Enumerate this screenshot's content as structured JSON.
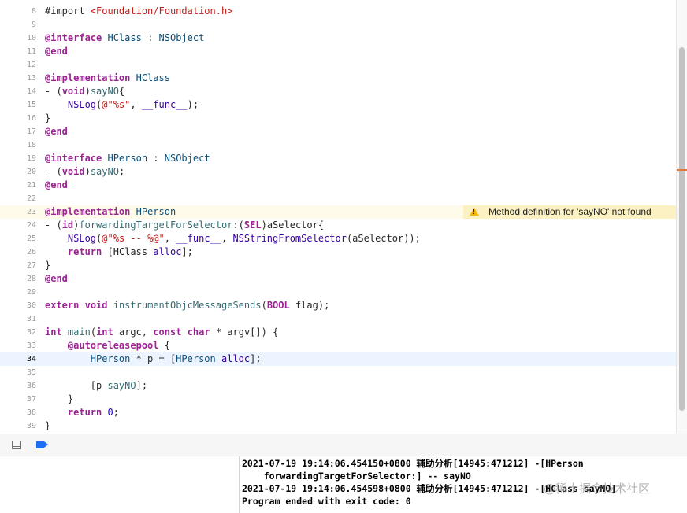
{
  "editor": {
    "lines": [
      {
        "num": "8",
        "tokens": [
          {
            "c": "",
            "t": "#import "
          },
          {
            "c": "s",
            "t": "<Foundation/Foundation.h>"
          }
        ]
      },
      {
        "num": "9",
        "tokens": []
      },
      {
        "num": "10",
        "tokens": [
          {
            "c": "k",
            "t": "@interface"
          },
          {
            "c": "",
            "t": " "
          },
          {
            "c": "t",
            "t": "HClass"
          },
          {
            "c": "",
            "t": " : "
          },
          {
            "c": "t",
            "t": "NSObject"
          }
        ]
      },
      {
        "num": "11",
        "tokens": [
          {
            "c": "k",
            "t": "@end"
          }
        ]
      },
      {
        "num": "12",
        "tokens": []
      },
      {
        "num": "13",
        "tokens": [
          {
            "c": "k",
            "t": "@implementation"
          },
          {
            "c": "",
            "t": " "
          },
          {
            "c": "t",
            "t": "HClass"
          }
        ]
      },
      {
        "num": "14",
        "tokens": [
          {
            "c": "",
            "t": "- ("
          },
          {
            "c": "k",
            "t": "void"
          },
          {
            "c": "",
            "t": ")"
          },
          {
            "c": "f",
            "t": "sayNO"
          },
          {
            "c": "",
            "t": "{"
          }
        ]
      },
      {
        "num": "15",
        "tokens": [
          {
            "c": "",
            "t": "    "
          },
          {
            "c": "m",
            "t": "NSLog"
          },
          {
            "c": "",
            "t": "("
          },
          {
            "c": "s",
            "t": "@\"%s\""
          },
          {
            "c": "",
            "t": ", "
          },
          {
            "c": "m",
            "t": "__func__"
          },
          {
            "c": "",
            "t": ");"
          }
        ]
      },
      {
        "num": "16",
        "tokens": [
          {
            "c": "",
            "t": "}"
          }
        ]
      },
      {
        "num": "17",
        "tokens": [
          {
            "c": "k",
            "t": "@end"
          }
        ]
      },
      {
        "num": "18",
        "tokens": []
      },
      {
        "num": "19",
        "tokens": [
          {
            "c": "k",
            "t": "@interface"
          },
          {
            "c": "",
            "t": " "
          },
          {
            "c": "t",
            "t": "HPerson"
          },
          {
            "c": "",
            "t": " : "
          },
          {
            "c": "t",
            "t": "NSObject"
          }
        ]
      },
      {
        "num": "20",
        "tokens": [
          {
            "c": "",
            "t": "- ("
          },
          {
            "c": "k",
            "t": "void"
          },
          {
            "c": "",
            "t": ")"
          },
          {
            "c": "f",
            "t": "sayNO"
          },
          {
            "c": "",
            "t": ";"
          }
        ]
      },
      {
        "num": "21",
        "tokens": [
          {
            "c": "k",
            "t": "@end"
          }
        ]
      },
      {
        "num": "22",
        "tokens": []
      },
      {
        "num": "23",
        "state": "warn",
        "tokens": [
          {
            "c": "k",
            "t": "@implementation"
          },
          {
            "c": "",
            "t": " "
          },
          {
            "c": "t",
            "t": "HPerson"
          }
        ]
      },
      {
        "num": "24",
        "tokens": [
          {
            "c": "",
            "t": "- ("
          },
          {
            "c": "k",
            "t": "id"
          },
          {
            "c": "",
            "t": ")"
          },
          {
            "c": "f",
            "t": "forwardingTargetForSelector"
          },
          {
            "c": "",
            "t": ":("
          },
          {
            "c": "k",
            "t": "SEL"
          },
          {
            "c": "",
            "t": ")aSelector{"
          }
        ]
      },
      {
        "num": "25",
        "tokens": [
          {
            "c": "",
            "t": "    "
          },
          {
            "c": "m",
            "t": "NSLog"
          },
          {
            "c": "",
            "t": "("
          },
          {
            "c": "s",
            "t": "@\"%s -- %@\""
          },
          {
            "c": "",
            "t": ", "
          },
          {
            "c": "m",
            "t": "__func__"
          },
          {
            "c": "",
            "t": ", "
          },
          {
            "c": "m",
            "t": "NSStringFromSelector"
          },
          {
            "c": "",
            "t": "(aSelector));"
          }
        ]
      },
      {
        "num": "26",
        "tokens": [
          {
            "c": "",
            "t": "    "
          },
          {
            "c": "k",
            "t": "return"
          },
          {
            "c": "",
            "t": " [HClass "
          },
          {
            "c": "m",
            "t": "alloc"
          },
          {
            "c": "",
            "t": "];"
          }
        ]
      },
      {
        "num": "27",
        "tokens": [
          {
            "c": "",
            "t": "}"
          }
        ]
      },
      {
        "num": "28",
        "tokens": [
          {
            "c": "k",
            "t": "@end"
          }
        ]
      },
      {
        "num": "29",
        "tokens": []
      },
      {
        "num": "30",
        "tokens": [
          {
            "c": "k",
            "t": "extern"
          },
          {
            "c": "",
            "t": " "
          },
          {
            "c": "k",
            "t": "void"
          },
          {
            "c": "",
            "t": " "
          },
          {
            "c": "f",
            "t": "instrumentObjcMessageSends"
          },
          {
            "c": "",
            "t": "("
          },
          {
            "c": "k",
            "t": "BOOL"
          },
          {
            "c": "",
            "t": " flag);"
          }
        ]
      },
      {
        "num": "31",
        "tokens": []
      },
      {
        "num": "32",
        "tokens": [
          {
            "c": "k",
            "t": "int"
          },
          {
            "c": "",
            "t": " "
          },
          {
            "c": "f",
            "t": "main"
          },
          {
            "c": "",
            "t": "("
          },
          {
            "c": "k",
            "t": "int"
          },
          {
            "c": "",
            "t": " argc, "
          },
          {
            "c": "k",
            "t": "const"
          },
          {
            "c": "",
            "t": " "
          },
          {
            "c": "k",
            "t": "char"
          },
          {
            "c": "",
            "t": " * argv[]) {"
          }
        ]
      },
      {
        "num": "33",
        "tokens": [
          {
            "c": "",
            "t": "    "
          },
          {
            "c": "k",
            "t": "@autoreleasepool"
          },
          {
            "c": "",
            "t": " {"
          }
        ]
      },
      {
        "num": "34",
        "state": "current",
        "tokens": [
          {
            "c": "",
            "t": "        "
          },
          {
            "c": "t",
            "t": "HPerson"
          },
          {
            "c": "",
            "t": " * p = ["
          },
          {
            "c": "t",
            "t": "HPerson"
          },
          {
            "c": "",
            "t": " "
          },
          {
            "c": "m",
            "t": "alloc"
          },
          {
            "c": "",
            "t": "];"
          }
        ]
      },
      {
        "num": "35",
        "tokens": []
      },
      {
        "num": "36",
        "tokens": [
          {
            "c": "",
            "t": "        [p "
          },
          {
            "c": "f",
            "t": "sayNO"
          },
          {
            "c": "",
            "t": "];"
          }
        ]
      },
      {
        "num": "37",
        "tokens": [
          {
            "c": "",
            "t": "    }"
          }
        ]
      },
      {
        "num": "38",
        "tokens": [
          {
            "c": "",
            "t": "    "
          },
          {
            "c": "k",
            "t": "return"
          },
          {
            "c": "",
            "t": " "
          },
          {
            "c": "n",
            "t": "0"
          },
          {
            "c": "",
            "t": ";"
          }
        ]
      },
      {
        "num": "39",
        "tokens": [
          {
            "c": "",
            "t": "}"
          }
        ]
      }
    ],
    "warning": {
      "line": "23",
      "message": "Method definition for 'sayNO' not found",
      "icon": "warning-triangle-icon"
    }
  },
  "debug_bar": {
    "hide_icon": "hide-debug-area-icon",
    "breakpoint_icon": "breakpoint-toggle-icon"
  },
  "console": {
    "lines": [
      "2021-07-19 19:14:06.454150+0800 辅助分析[14945:471212] -[HPerson",
      "    forwardingTargetForSelector:] -- sayNO",
      "2021-07-19 19:14:06.454598+0800 辅助分析[14945:471212] -[HClass sayNO]",
      "Program ended with exit code: 0"
    ]
  },
  "watermark": "@稀土掘金技术社区"
}
